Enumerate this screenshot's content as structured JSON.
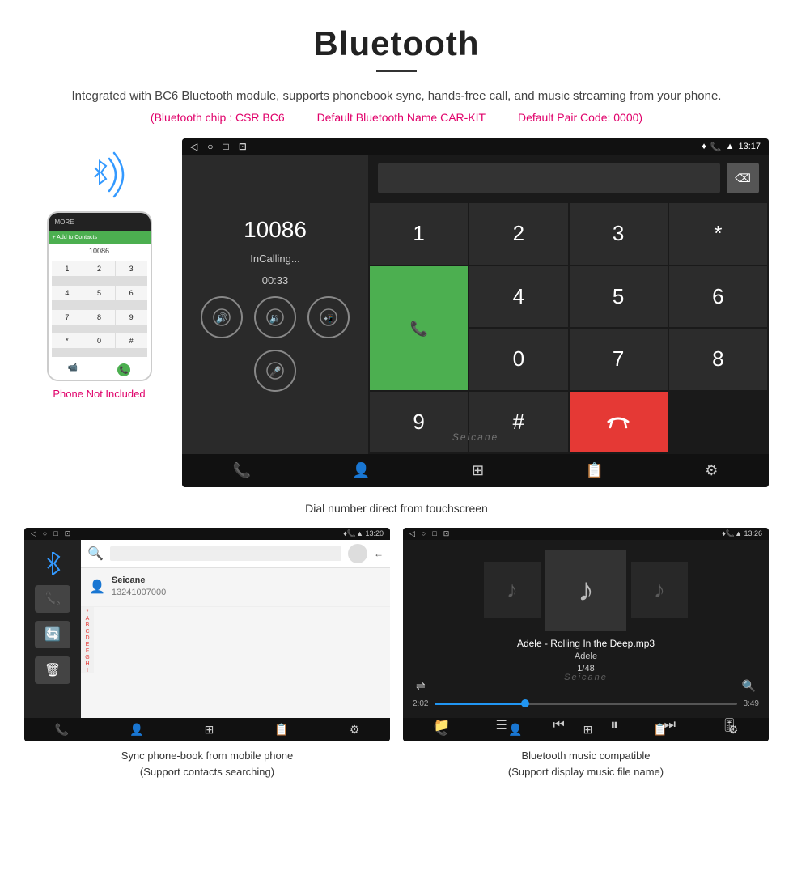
{
  "page": {
    "title": "Bluetooth",
    "subtitle": "Integrated with BC6 Bluetooth module, supports phonebook sync, hands-free call, and music streaming from your phone.",
    "pink_info": {
      "chip": "(Bluetooth chip : CSR BC6",
      "name": "Default Bluetooth Name CAR-KIT",
      "code": "Default Pair Code: 0000)"
    },
    "top_caption": "Dial number direct from touchscreen",
    "bottom_left_caption": "Sync phone-book from mobile phone\n(Support contacts searching)",
    "bottom_right_caption": "Bluetooth music compatible\n(Support display music file name)"
  },
  "top_screen": {
    "status_bar": {
      "left_icons": [
        "◁",
        "○",
        "□",
        "⊡"
      ],
      "right_icons": [
        "📍",
        "📞",
        "▲",
        "13:17"
      ]
    },
    "dialer": {
      "number": "10086",
      "status": "InCalling...",
      "timer": "00:33",
      "numpad_keys": [
        "1",
        "2",
        "3",
        "*",
        "4",
        "5",
        "6",
        "0",
        "7",
        "8",
        "9",
        "#"
      ]
    },
    "bottom_icons": [
      "📞",
      "👤",
      "⊞",
      "📋",
      "⚙"
    ]
  },
  "phonebook_screen": {
    "status_bar": {
      "right": "📍📞▲ 13:20"
    },
    "contact": {
      "name": "Seicane",
      "number": "13241007000"
    },
    "alpha_list": [
      "*",
      "A",
      "B",
      "C",
      "D",
      "E",
      "F",
      "G",
      "H",
      "I"
    ]
  },
  "music_screen": {
    "status_bar": {
      "right": "📍📞▲ 13:26"
    },
    "track": {
      "title": "Adele - Rolling In the Deep.mp3",
      "artist": "Adele",
      "position": "1/48"
    },
    "time_current": "2:02",
    "time_total": "3:49",
    "watermark": "Seicane"
  },
  "phone_not_included": "Phone Not Included"
}
